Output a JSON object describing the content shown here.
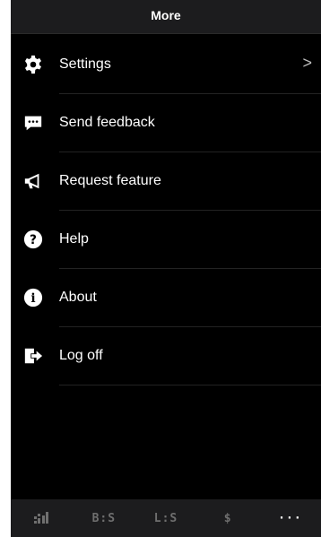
{
  "header": {
    "title": "More"
  },
  "menu": {
    "items": [
      {
        "label": "Settings",
        "icon": "gear-icon",
        "chevron": ">"
      },
      {
        "label": "Send feedback",
        "icon": "chat-bubble-icon"
      },
      {
        "label": "Request feature",
        "icon": "megaphone-icon"
      },
      {
        "label": "Help",
        "icon": "question-circle-icon"
      },
      {
        "label": "About",
        "icon": "info-circle-icon"
      },
      {
        "label": "Log off",
        "icon": "logout-icon"
      }
    ]
  },
  "annotation": {
    "label": "More"
  },
  "tabbar": {
    "tabs": [
      {
        "icon": "dashboard-icon"
      },
      {
        "label": "B:S"
      },
      {
        "label": "L:S"
      },
      {
        "label": "$"
      },
      {
        "label": "···",
        "active": true
      }
    ]
  },
  "colors": {
    "background": "#000000",
    "bar_background": "#1c1c1e",
    "text": "#ffffff",
    "inactive_tab": "#6f6f6f"
  }
}
